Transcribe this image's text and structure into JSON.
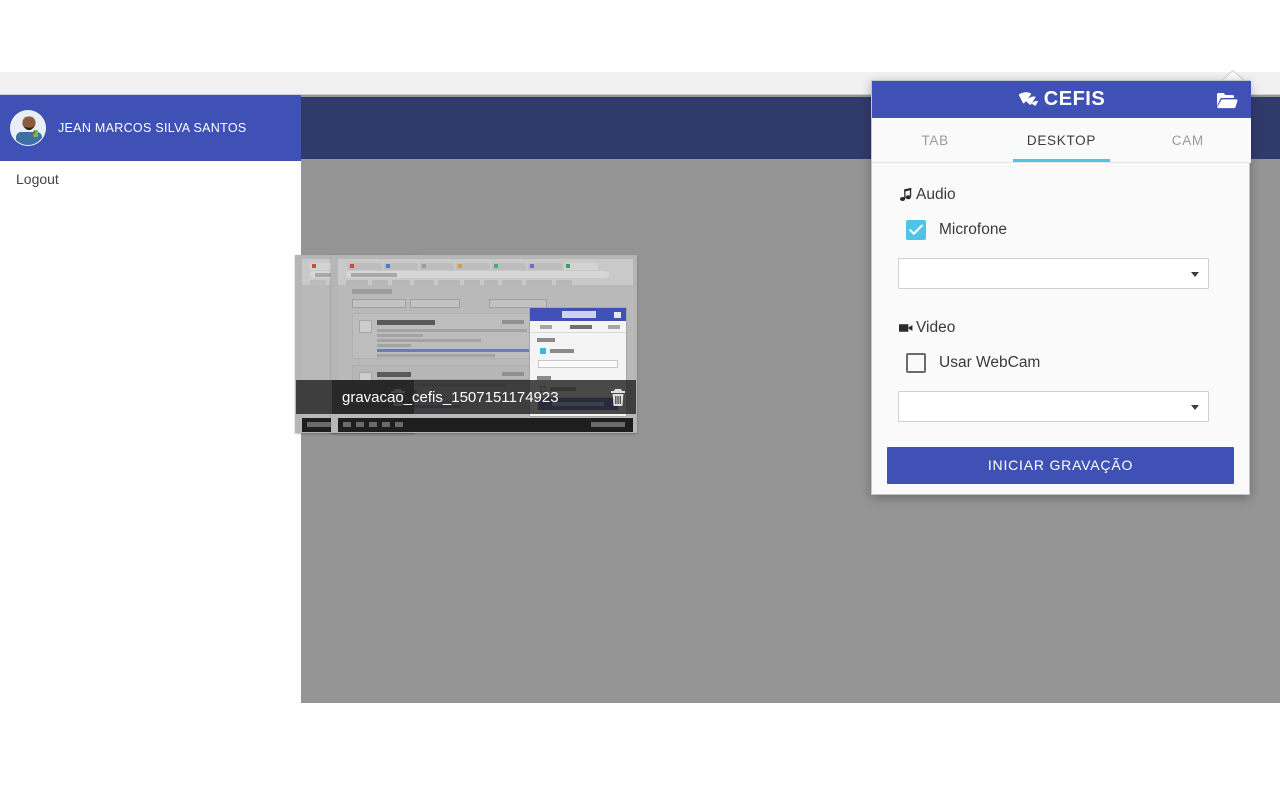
{
  "app": {
    "sidebar": {
      "user_name": "JEAN MARCOS SILVA SANTOS",
      "avatar_icon": "user-photo-avatar",
      "menu": [
        {
          "label": "Logout",
          "name": "logout"
        }
      ]
    },
    "recordings": [
      {
        "filename": "",
        "delete_icon": "trash-icon",
        "hidden": true
      },
      {
        "filename": "gravacao_cefis_1507151174923",
        "delete_icon": "trash-icon",
        "hidden": false
      }
    ]
  },
  "popup": {
    "brand": {
      "name": "CEFIS",
      "logo_icon": "cefis-book-logo-icon"
    },
    "folder_icon": "open-folder-icon",
    "tabs": [
      {
        "label": "TAB",
        "active": false
      },
      {
        "label": "DESKTOP",
        "active": true
      },
      {
        "label": "CAM",
        "active": false
      }
    ],
    "audio": {
      "title": "Audio",
      "icon": "music-note-icon",
      "checkbox": {
        "label": "Microfone",
        "checked": true
      },
      "select": {
        "value": "",
        "placeholder": ""
      }
    },
    "video": {
      "title": "Video",
      "icon": "video-camera-icon",
      "checkbox": {
        "label": "Usar WebCam",
        "checked": false
      },
      "select": {
        "value": "",
        "placeholder": ""
      }
    },
    "cta_label": "INICIAR GRAVAÇÃO"
  },
  "colors": {
    "brand_blue": "#3f51b5",
    "topbar_dark_blue": "#303b6b",
    "accent_cyan": "#4fc3e8",
    "overlay_gray": "#959595",
    "checkbox_on": "#4fc3e8"
  }
}
